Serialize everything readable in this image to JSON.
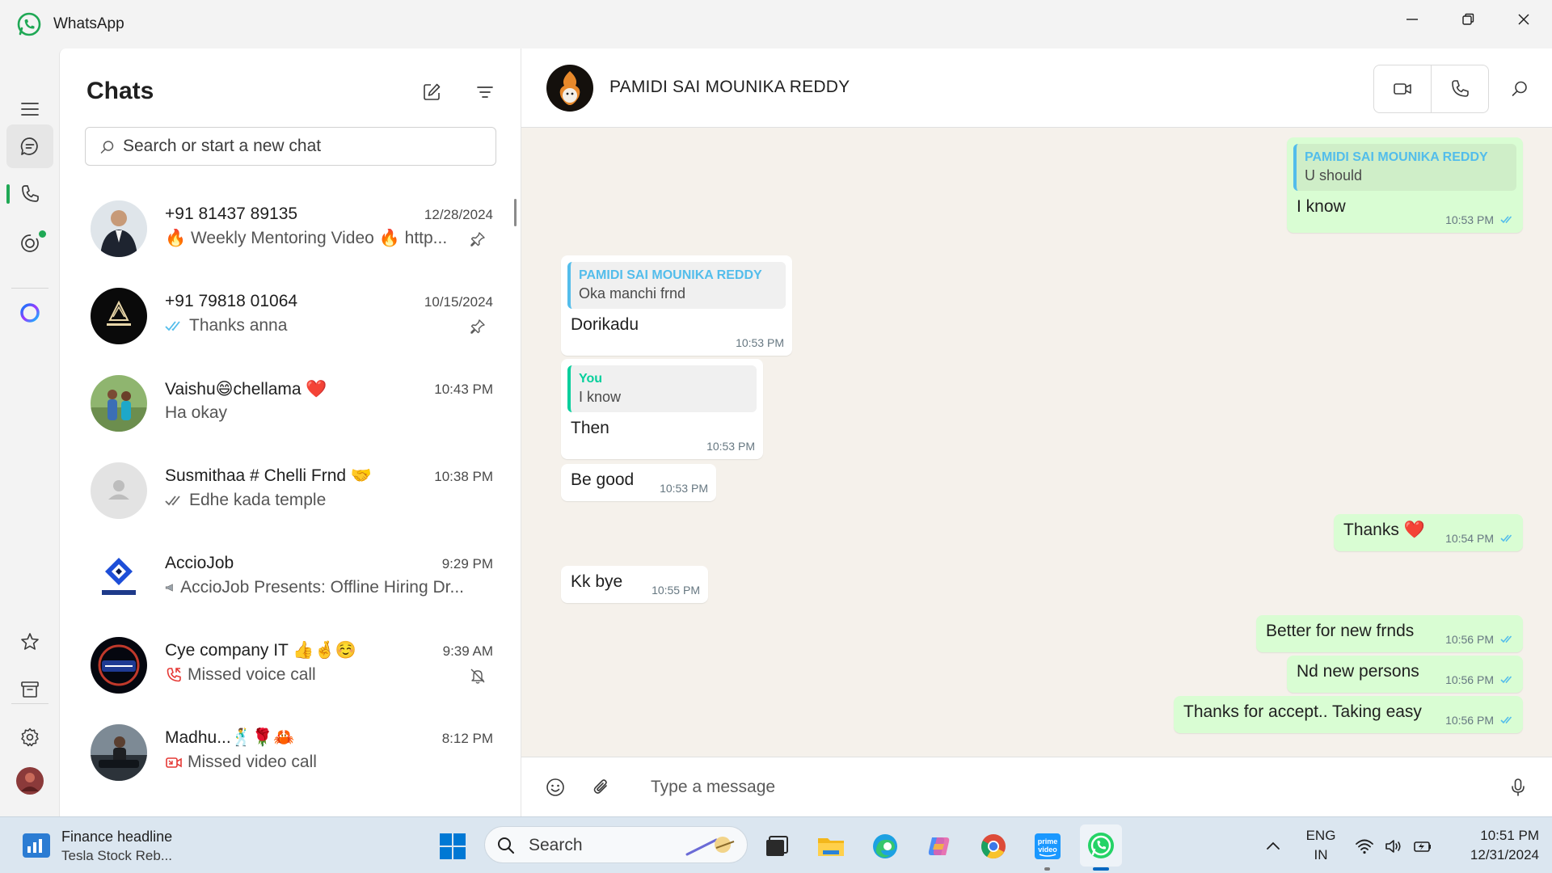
{
  "window": {
    "title": "WhatsApp",
    "accent_color": "#1fa855"
  },
  "rail": {
    "items": [
      {
        "name": "menu",
        "icon": "hamburger-icon"
      },
      {
        "name": "chats",
        "icon": "chat-icon",
        "active": true
      },
      {
        "name": "calls",
        "icon": "phone-icon"
      },
      {
        "name": "status",
        "icon": "status-icon",
        "unread_dot": true
      },
      {
        "name": "meta-ai",
        "icon": "meta-ai-icon"
      },
      {
        "name": "starred",
        "icon": "star-icon"
      },
      {
        "name": "archived",
        "icon": "archive-icon"
      },
      {
        "name": "settings",
        "icon": "gear-icon"
      },
      {
        "name": "profile",
        "icon": "profile-avatar"
      }
    ]
  },
  "chat_list": {
    "title": "Chats",
    "search_placeholder": "Search or start a new chat",
    "chats": [
      {
        "name": "+91 81437 89135",
        "time": "12/28/2024",
        "preview": "🔥 Weekly Mentoring Video 🔥 http...",
        "status": "none",
        "pinned": true,
        "avatar_color": "#5b6a7a"
      },
      {
        "name": "+91 79818 01064",
        "time": "10/15/2024",
        "preview": "Thanks anna",
        "status": "read",
        "pinned": true,
        "avatar_color": "#0a0a0a"
      },
      {
        "name": "Vaishu😄chellama ❤️",
        "time": "10:43 PM",
        "preview": "Ha okay",
        "status": "none",
        "pinned": false,
        "avatar_color": "#6f9a5a"
      },
      {
        "name": "Susmithaa   # Chelli Frnd 🤝",
        "time": "10:38 PM",
        "preview": "Edhe kada temple",
        "status": "delivered",
        "pinned": false,
        "avatar_color": "#d9d9d9"
      },
      {
        "name": "AccioJob",
        "time": "9:29 PM",
        "preview": "AccioJob Presents: Offline Hiring Dr...",
        "status": "megaphone",
        "pinned": false,
        "avatar_color": "#ffffff"
      },
      {
        "name": "Cye company IT 👍🤞☺️",
        "time": "9:39 AM",
        "preview": "Missed voice call",
        "status": "missed-voice",
        "muted": true,
        "avatar_color": "#0b0f2a"
      },
      {
        "name": "Madhu...🕺🌹🦀",
        "time": "8:12 PM",
        "preview": "Missed video call",
        "status": "missed-video",
        "pinned": false,
        "avatar_color": "#3f4a55"
      }
    ]
  },
  "conversation": {
    "contact_name": "PAMIDI SAI MOUNIKA REDDY",
    "composer_placeholder": "Type a message",
    "messages": [
      {
        "dir": "out",
        "quote_author": "PAMIDI SAI MOUNIKA REDDY",
        "quote_text": "U should",
        "text": "I know",
        "time": "10:53 PM",
        "ticks": "read"
      },
      {
        "dir": "in",
        "quote_author": "PAMIDI SAI MOUNIKA REDDY",
        "quote_text": "Oka manchi frnd",
        "text": "Dorikadu",
        "time": "10:53 PM"
      },
      {
        "dir": "in",
        "quote_author": "You",
        "quote_text": "I know",
        "text": "Then",
        "time": "10:53 PM"
      },
      {
        "dir": "in",
        "text": "Be good",
        "time": "10:53 PM"
      },
      {
        "dir": "out",
        "text": "Thanks ❤️",
        "time": "10:54 PM",
        "ticks": "read"
      },
      {
        "dir": "in",
        "text": "Kk bye",
        "time": "10:55 PM"
      },
      {
        "dir": "out",
        "text": "Better for new frnds",
        "time": "10:56 PM",
        "ticks": "read"
      },
      {
        "dir": "out",
        "text": "Nd new persons",
        "time": "10:56 PM",
        "ticks": "read"
      },
      {
        "dir": "out",
        "text": "Thanks for accept.. Taking easy",
        "time": "10:56 PM",
        "ticks": "read"
      }
    ]
  },
  "taskbar": {
    "widget_title": "Finance headline",
    "widget_subtitle": "Tesla Stock Reb...",
    "search_label": "Search",
    "language": "ENG",
    "region": "IN",
    "clock_time": "10:51 PM",
    "clock_date": "12/31/2024",
    "pinned_apps": [
      "start-icon",
      "task-view-icon",
      "file-explorer-icon",
      "edge-icon",
      "copilot-icon",
      "chrome-icon",
      "prime-video-icon",
      "whatsapp-icon"
    ]
  }
}
